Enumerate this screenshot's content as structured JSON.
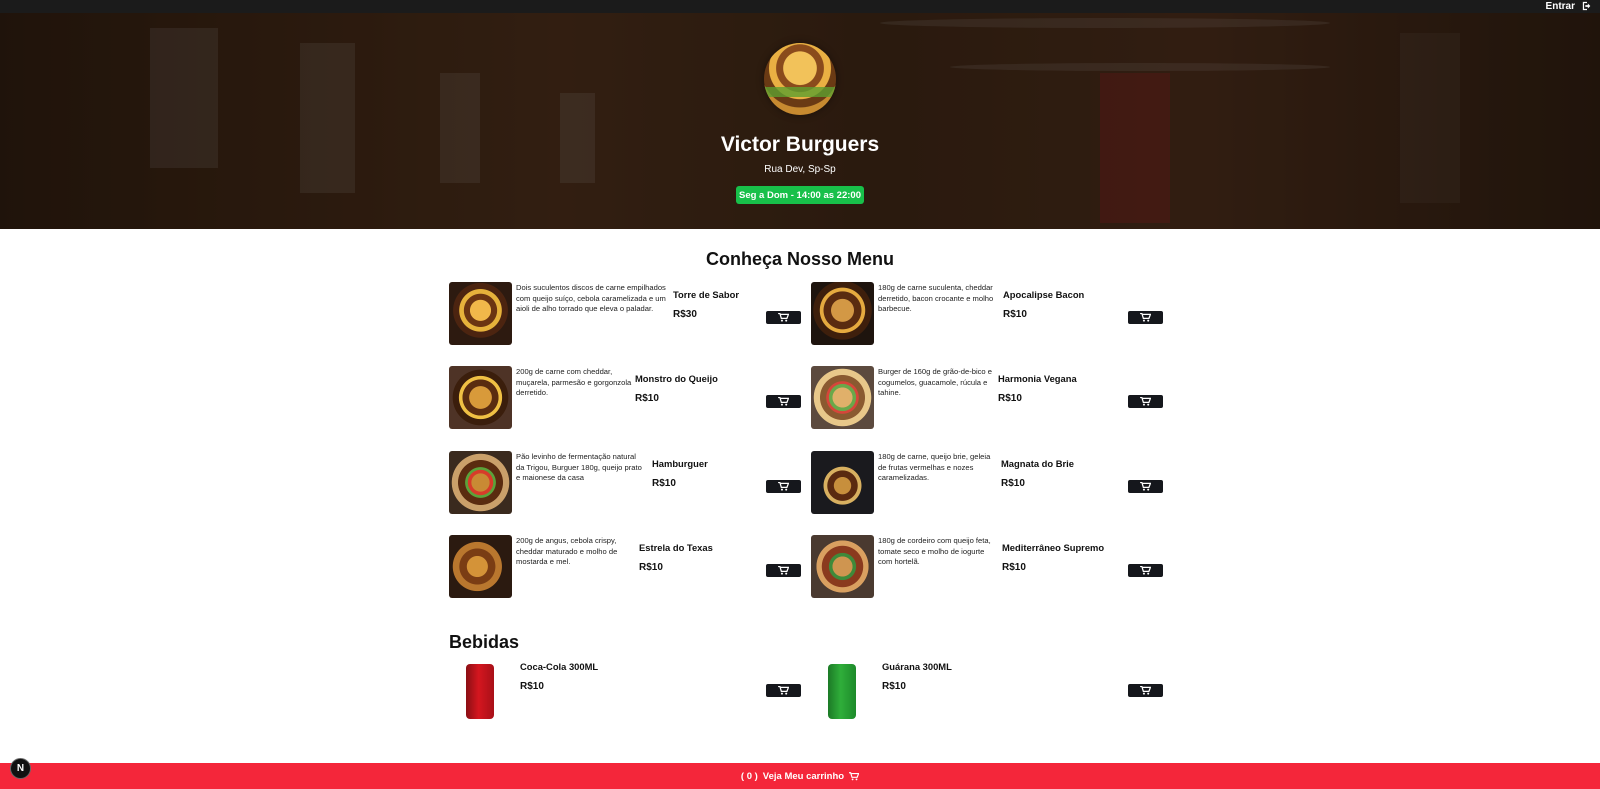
{
  "header": {
    "login_label": "Entrar",
    "login_icon": "sign-out-icon"
  },
  "restaurant": {
    "name": "Victor Burguers",
    "address": "Rua Dev, Sp-Sp",
    "hours": "Seg a Dom - 14:00 as 22:00",
    "hours_color": "#18c04a"
  },
  "menu": {
    "title": "Conheça Nosso Menu",
    "items": [
      {
        "name": "Torre de Sabor",
        "price": "R$30",
        "description": "Dois suculentos discos de carne empilhados com queijo suíço, cebola caramelizada e um aioli de alho torrado que eleva o paladar."
      },
      {
        "name": "Apocalipse Bacon",
        "price": "R$10",
        "description": "180g de carne suculenta, cheddar derretido, bacon crocante e molho barbecue."
      },
      {
        "name": "Monstro do Queijo",
        "price": "R$10",
        "description": "200g de carne com cheddar, muçarela, parmesão e gorgonzola derretido."
      },
      {
        "name": "Harmonia Vegana",
        "price": "R$10",
        "description": "Burger de 160g de grão-de-bico e cogumelos, guacamole, rúcula e tahine."
      },
      {
        "name": "Hamburguer",
        "price": "R$10",
        "description": "Pão levinho de fermentação natural da Trigou, Burguer 180g, queijo prato e maionese da casa"
      },
      {
        "name": "Magnata do Brie",
        "price": "R$10",
        "description": "180g de carne, queijo brie, geleia de frutas vermelhas e nozes caramelizadas."
      },
      {
        "name": "Estrela do Texas",
        "price": "R$10",
        "description": "200g de angus, cebola crispy, cheddar maturado e molho de mostarda e mel."
      },
      {
        "name": "Mediterrâneo Supremo",
        "price": "R$10",
        "description": "180g de cordeiro com queijo feta, tomate seco e molho de iogurte com hortelã."
      }
    ]
  },
  "drinks": {
    "title": "Bebidas",
    "items": [
      {
        "name": "Coca-Cola 300ML",
        "price": "R$10"
      },
      {
        "name": "Guárana 300ML",
        "price": "R$10"
      }
    ]
  },
  "cart": {
    "count_text": "( 0 )",
    "label": "Veja Meu carrinho",
    "bar_color": "#f4263a"
  },
  "dev_badge": "N"
}
